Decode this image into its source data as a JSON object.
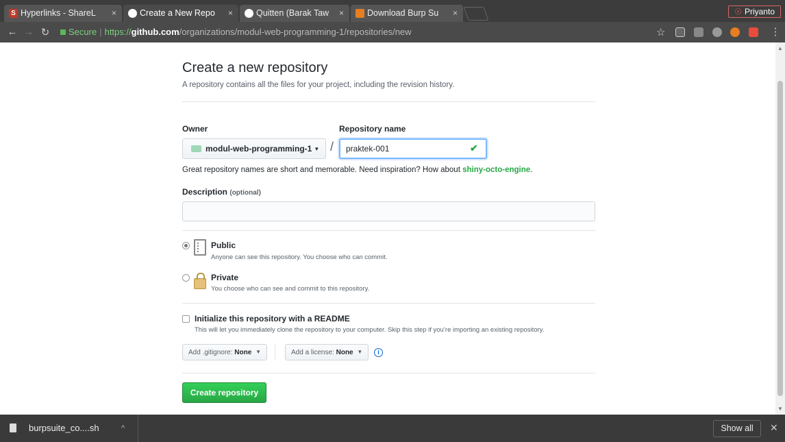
{
  "browser": {
    "tabs": [
      {
        "title": "Hyperlinks - ShareL",
        "favicon_color": "#c0392b",
        "favicon_letter": "S"
      },
      {
        "title": "Create a New Repo",
        "favicon_color": "#ffffff",
        "favicon_letter": ""
      },
      {
        "title": "Quitten (Barak Taw",
        "favicon_color": "#ffffff",
        "favicon_letter": ""
      },
      {
        "title": "Download Burp Su",
        "favicon_color": "#e67e22",
        "favicon_letter": ""
      }
    ],
    "tab_close": "×",
    "profile_name": "Priyanto",
    "url": {
      "secure_label": "Secure",
      "scheme": "https://",
      "host": "github.com",
      "path": "/organizations/modul-web-programming-1/repositories/new"
    }
  },
  "page": {
    "title": "Create a new repository",
    "subtitle": "A repository contains all the files for your project, including the revision history.",
    "owner_label": "Owner",
    "owner_value": "modul-web-programming-1",
    "repo_name_label": "Repository name",
    "repo_name_value": "praktek-001",
    "slash": "/",
    "hint_prefix": "Great repository names are short and memorable. Need inspiration? How about ",
    "hint_suggestion": "shiny-octo-engine",
    "hint_suffix": ".",
    "description_label": "Description",
    "description_optional": "(optional)",
    "description_value": "",
    "visibility": {
      "selected": "public",
      "public_title": "Public",
      "public_desc": "Anyone can see this repository. You choose who can commit.",
      "private_title": "Private",
      "private_desc": "You choose who can see and commit to this repository."
    },
    "readme": {
      "checked": false,
      "title": "Initialize this repository with a README",
      "desc": "This will let you immediately clone the repository to your computer. Skip this step if you’re importing an existing repository."
    },
    "gitignore_label": "Add .gitignore:",
    "gitignore_value": "None",
    "license_label": "Add a license:",
    "license_value": "None",
    "create_button": "Create repository",
    "accent_color": "#28a745"
  },
  "downloads": {
    "file_name": "burpsuite_co....sh",
    "show_all": "Show all"
  }
}
